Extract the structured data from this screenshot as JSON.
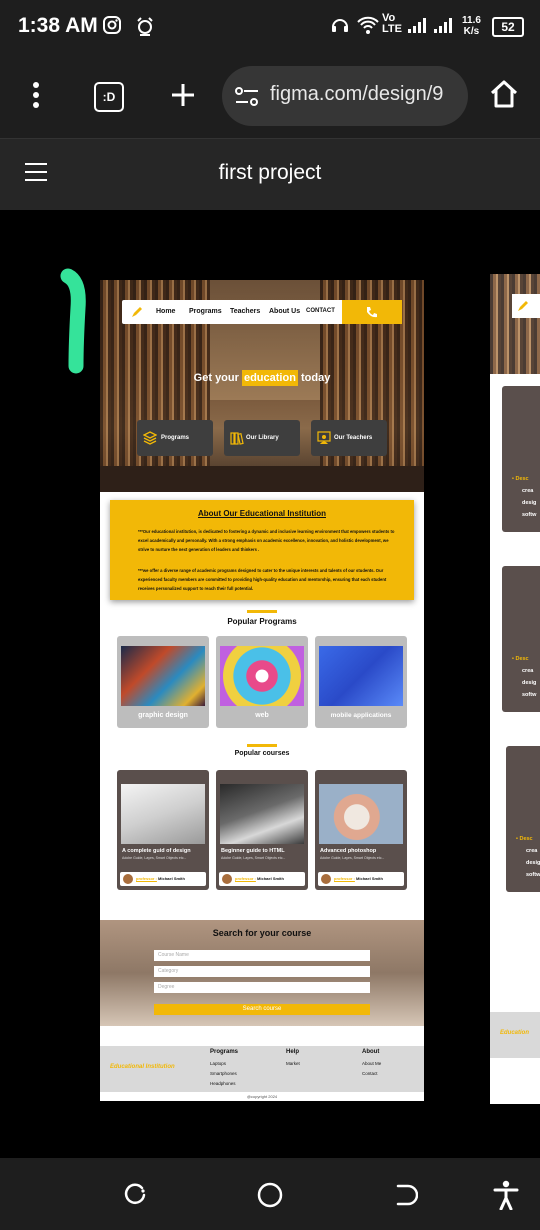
{
  "status_bar": {
    "time": "1:38 AM",
    "network_type": "LTE",
    "speed_value": "11.6",
    "speed_unit": "K/s",
    "battery": "52"
  },
  "browser": {
    "url": "figma.com/design/9",
    "tab_icon": ":D"
  },
  "figma": {
    "title": "first project"
  },
  "design": {
    "nav": {
      "links": [
        "Home",
        "Programs",
        "Teachers",
        "About Us",
        "CONTACT"
      ]
    },
    "hero": {
      "title_prefix": "Get your",
      "title_highlight": "education",
      "title_suffix": "today",
      "cards": [
        "Programs",
        "Our Library",
        "Our Teachers"
      ]
    },
    "about": {
      "title": "About Our Educational Institution",
      "p1": "***Our educational institution, is dedicated to fostering a dynamic and inclusive learning environment that empowers students to excel academically and personally. With a strong emphasis on academic excellence, innovation, and holistic development, we strive to nurture the next generation of leaders and thinkers .",
      "p2": "***we offer a diverse range of academic programs designed to cater to the unique interests and talents of our students. Our experienced faculty members are committed to providing high-quality education and mentorship, ensuring that each student receives personalized support to reach their full potential."
    },
    "popular_programs": {
      "title": "Popular Programs",
      "items": [
        "graphic design",
        "web",
        "mobile applications"
      ]
    },
    "popular_courses": {
      "title": "Popular courses",
      "items": [
        {
          "title": "A complete guid of design",
          "sub": "Adobe Guide, Layes, Smart Objects etc...",
          "prof_prefix": "professor :",
          "prof": "Michael Smith"
        },
        {
          "title": "Beginner guide to HTML",
          "sub": "Adobe Guide, Layes, Smart Objects etc...",
          "prof_prefix": "professor :",
          "prof": "Michael Smith"
        },
        {
          "title": "Advanced photoshop",
          "sub": "Adobe Guide, Layes, Smart Objects etc...",
          "prof_prefix": "professor :",
          "prof": "Michael Smith"
        }
      ]
    },
    "search": {
      "title": "Search for your course",
      "ph_name": "Course Name",
      "ph_category": "Category",
      "ph_degree": "Degree",
      "button": "Search course"
    },
    "footer": {
      "brand": "Educational Institution",
      "col1": {
        "head": "Programs",
        "items": [
          "Laptops",
          "Smartphones",
          "Headphones"
        ]
      },
      "col2": {
        "head": "Help",
        "items": [
          "Market"
        ]
      },
      "col3": {
        "head": "About",
        "items": [
          "About Me",
          "Contact"
        ]
      },
      "copyright": "@copyright 2024"
    }
  },
  "partial_frame": {
    "bullet_text": "Desc",
    "lines": [
      "crea",
      "desig",
      "softw"
    ],
    "footer_brand": "Education"
  },
  "colors": {
    "accent": "#f2b807",
    "annotation": "#35e39a",
    "card_dark": "#5a4f4c"
  }
}
